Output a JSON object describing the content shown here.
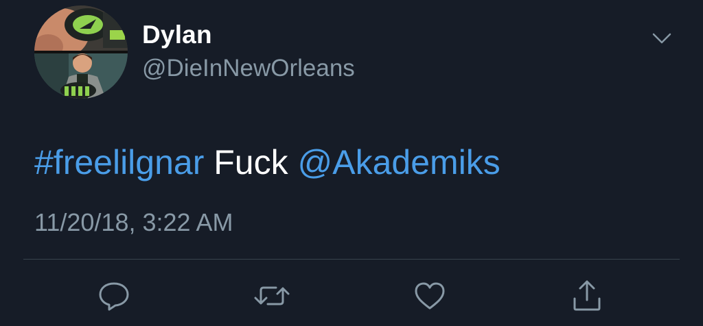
{
  "author": {
    "display_name": "Dylan",
    "handle": "@DieInNewOrleans",
    "avatar_icon": "cartoon-avatar"
  },
  "tweet": {
    "hashtag": "#freelilgnar",
    "text": " Fuck ",
    "mention": "@Akademiks",
    "timestamp": "11/20/18, 3:22 AM"
  },
  "actions": [
    {
      "name": "reply",
      "icon": "reply-icon"
    },
    {
      "name": "retweet",
      "icon": "retweet-icon"
    },
    {
      "name": "like",
      "icon": "heart-icon"
    },
    {
      "name": "share",
      "icon": "share-icon"
    }
  ],
  "colors": {
    "background": "#161c27",
    "text": "#ffffff",
    "secondary": "#8899a6",
    "link": "#4a9de8",
    "divider": "#38444d"
  }
}
